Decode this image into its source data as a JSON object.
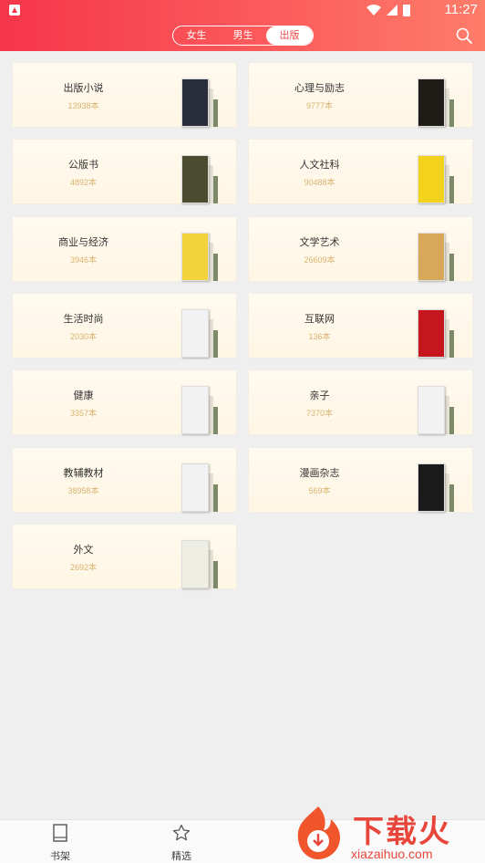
{
  "status": {
    "time": "11:27"
  },
  "tabs": [
    {
      "label": "女生",
      "active": false
    },
    {
      "label": "男生",
      "active": false
    },
    {
      "label": "出版",
      "active": true
    }
  ],
  "categories": [
    {
      "name": "出版小说",
      "count": "13938本",
      "cover": "#2a2d3c"
    },
    {
      "name": "心理与励志",
      "count": "9777本",
      "cover": "#1f1b16"
    },
    {
      "name": "公版书",
      "count": "4892本",
      "cover": "#4a4b2f"
    },
    {
      "name": "人文社科",
      "count": "90488本",
      "cover": "#f2d21a"
    },
    {
      "name": "商业与经济",
      "count": "3946本",
      "cover": "#f3d33b"
    },
    {
      "name": "文学艺术",
      "count": "26609本",
      "cover": "#d8a85a"
    },
    {
      "name": "生活时尚",
      "count": "2030本",
      "cover": "#f2f2f2"
    },
    {
      "name": "互联网",
      "count": "136本",
      "cover": "#c4161c"
    },
    {
      "name": "健康",
      "count": "3357本",
      "cover": "#f2f2f2"
    },
    {
      "name": "亲子",
      "count": "7370本",
      "cover": "#f2f2f2"
    },
    {
      "name": "教辅教材",
      "count": "38958本",
      "cover": "#f2f2f2"
    },
    {
      "name": "漫画杂志",
      "count": "569本",
      "cover": "#1a1a1a"
    },
    {
      "name": "外文",
      "count": "2692本",
      "cover": "#efeee4"
    }
  ],
  "bottom_nav": [
    {
      "label": "书架",
      "icon": "bookshelf-icon"
    },
    {
      "label": "精选",
      "icon": "star-icon"
    }
  ],
  "watermark": {
    "text": "下载火",
    "url": "xiazaihuo.com"
  },
  "colors": {
    "accent": "#f6364a",
    "count": "#d9b371",
    "card_bg": "#fff8ea"
  }
}
